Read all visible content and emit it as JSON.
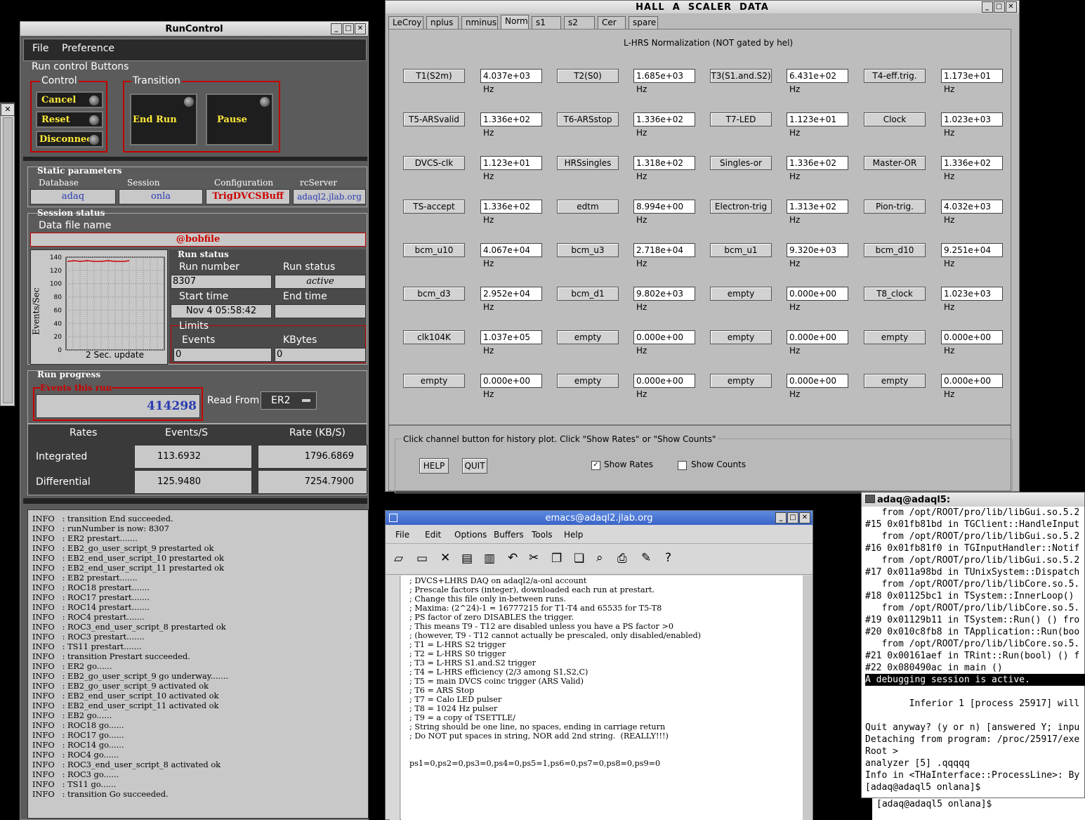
{
  "runcontrol": {
    "title": "RunControl",
    "menu": [
      "File",
      "Preference"
    ],
    "buttons_group": "Run control Buttons",
    "control_label": "Control",
    "control_buttons": [
      "Cancel",
      "Reset",
      "Disconnect"
    ],
    "transition_label": "Transition",
    "transition_buttons": [
      "End Run",
      "Pause"
    ],
    "static_params_label": "Static parameters",
    "static_params": [
      {
        "label": "Database",
        "value": "adaq"
      },
      {
        "label": "Session",
        "value": "onla"
      },
      {
        "label": "Configuration",
        "value": "TrigDVCSBuff"
      },
      {
        "label": "rcServer",
        "value": "adaql2.jlab.org"
      }
    ],
    "session_status_label": "Session status",
    "data_file_label": "Data file name",
    "data_file": "@bobfile",
    "plot": {
      "ylabel": "Events/Sec",
      "yticks": [
        "140",
        "120",
        "100",
        "80",
        "60",
        "40",
        "20",
        "0"
      ],
      "caption": "2 Sec. update"
    },
    "run_status_label": "Run status",
    "run_number_label": "Run number",
    "run_number": "8307",
    "run_status_field_label": "Run status",
    "run_status": "active",
    "start_time_label": "Start time",
    "start_time": "Nov 4 05:58:42",
    "end_time_label": "End time",
    "end_time": "",
    "limits_label": "Limits",
    "events_label": "Events",
    "events_limit": "0",
    "kbytes_label": "KBytes",
    "kbytes_limit": "0",
    "run_progress_label": "Run progress",
    "events_this_run_label": "Events this run",
    "events_this_run": "414298",
    "read_from_label": "Read From:",
    "read_from": "ER2",
    "rates_headers": [
      "Rates",
      "Events/S",
      "Rate (KB/S)"
    ],
    "rates": [
      {
        "label": "Integrated",
        "events": "113.6932",
        "rate": "1796.6869"
      },
      {
        "label": "Differential",
        "events": "125.9480",
        "rate": "7254.7900"
      }
    ],
    "log": [
      "INFO   : transition End succeeded.",
      "INFO   : runNumber is now: 8307",
      "INFO   : ER2 prestart.......",
      "INFO   : EB2_go_user_script_9 prestarted ok",
      "INFO   : EB2_end_user_script_10 prestarted ok",
      "INFO   : EB2_end_user_script_11 prestarted ok",
      "INFO   : EB2 prestart.......",
      "INFO   : ROC18 prestart.......",
      "INFO   : ROC17 prestart.......",
      "INFO   : ROC14 prestart.......",
      "INFO   : ROC4 prestart.......",
      "INFO   : ROC3_end_user_script_8 prestarted ok",
      "INFO   : ROC3 prestart.......",
      "INFO   : TS11 prestart.......",
      "INFO   : transition Prestart succeeded.",
      "INFO   : ER2 go......",
      "INFO   : EB2_go_user_script_9 go underway.......",
      "INFO   : EB2_go_user_script_9 activated ok",
      "INFO   : EB2_end_user_script_10 activated ok",
      "INFO   : EB2_end_user_script_11 activated ok",
      "INFO   : EB2 go......",
      "INFO   : ROC18 go......",
      "INFO   : ROC17 go......",
      "INFO   : ROC14 go......",
      "INFO   : ROC4 go......",
      "INFO   : ROC3_end_user_script_8 activated ok",
      "INFO   : ROC3 go......",
      "INFO   : TS11 go......",
      "INFO   : transition Go succeeded."
    ]
  },
  "scaler": {
    "title": "HALL  A  SCALER  DATA",
    "tabs": [
      "LeCroy",
      "nplus",
      "nminus",
      "Norm",
      "s1",
      "s2",
      "Cer",
      "spare"
    ],
    "active_tab": "Norm",
    "heading": "L-HRS Normalization (NOT gated by hel)",
    "rows": [
      [
        [
          "T1(S2m)",
          "4.037e+03 Hz"
        ],
        [
          "T2(S0)",
          "1.685e+03 Hz"
        ],
        [
          "T3(S1.and.S2)",
          "6.431e+02 Hz"
        ],
        [
          "T4-eff.trig.",
          "1.173e+01 Hz"
        ]
      ],
      [
        [
          "T5-ARSvalid",
          "1.336e+02 Hz"
        ],
        [
          "T6-ARSstop",
          "1.336e+02 Hz"
        ],
        [
          "T7-LED",
          "1.123e+01 Hz"
        ],
        [
          "Clock",
          "1.023e+03 Hz"
        ]
      ],
      [
        [
          "DVCS-clk",
          "1.123e+01 Hz"
        ],
        [
          "HRSsingles",
          "1.318e+02 Hz"
        ],
        [
          "Singles-or",
          "1.336e+02 Hz"
        ],
        [
          "Master-OR",
          "1.336e+02 Hz"
        ]
      ],
      [
        [
          "TS-accept",
          "1.336e+02 Hz"
        ],
        [
          "edtm",
          "8.994e+00 Hz"
        ],
        [
          "Electron-trig",
          "1.313e+02 Hz"
        ],
        [
          "Pion-trig.",
          "4.032e+03 Hz"
        ]
      ],
      [
        [
          "bcm_u10",
          "4.067e+04 Hz"
        ],
        [
          "bcm_u3",
          "2.718e+04 Hz"
        ],
        [
          "bcm_u1",
          "9.320e+03 Hz"
        ],
        [
          "bcm_d10",
          "9.251e+04 Hz"
        ]
      ],
      [
        [
          "bcm_d3",
          "2.952e+04 Hz"
        ],
        [
          "bcm_d1",
          "9.802e+03 Hz"
        ],
        [
          "empty",
          "0.000e+00 Hz"
        ],
        [
          "T8_clock",
          "1.023e+03 Hz"
        ]
      ],
      [
        [
          "clk104K",
          "1.037e+05 Hz"
        ],
        [
          "empty",
          "0.000e+00 Hz"
        ],
        [
          "empty",
          "0.000e+00 Hz"
        ],
        [
          "empty",
          "0.000e+00 Hz"
        ]
      ],
      [
        [
          "empty",
          "0.000e+00 Hz"
        ],
        [
          "empty",
          "0.000e+00 Hz"
        ],
        [
          "empty",
          "0.000e+00 Hz"
        ],
        [
          "empty",
          "0.000e+00 Hz"
        ]
      ]
    ],
    "footer_text": "Click channel button for history plot.  Click \"Show Rates\" or \"Show Counts\"",
    "help": "HELP",
    "quit": "QUIT",
    "show_rates": "Show Rates",
    "show_counts": "Show Counts"
  },
  "emacs": {
    "title": "emacs@adaql2.jlab.org",
    "menu": [
      "File",
      "Edit",
      "Options",
      "Buffers",
      "Tools",
      "Help"
    ],
    "lines": [
      "; DVCS+LHRS DAQ on adaql2/a-onl account",
      "; Prescale factors (integer), downloaded each run at prestart.",
      "; Change this file only in-between runs.",
      "; Maxima: (2^24)-1 = 16777215 for T1-T4 and 65535 for T5-T8",
      "; PS factor of zero DISABLES the trigger.",
      "; This means T9 - T12 are disabled unless you have a PS factor >0",
      "; (however, T9 - T12 cannot actually be prescaled, only disabled/enabled)",
      "; T1 = L-HRS S2 trigger",
      "; T2 = L-HRS S0 trigger",
      "; T3 = L-HRS S1.and.S2 trigger",
      "; T4 = L-HRS efficiency (2/3 among S1,S2,C)",
      "; T5 = main DVCS coinc trigger (ARS Valid)",
      "; T6 = ARS Stop",
      "; T7 = Calo LED pulser",
      "; T8 = 1024 Hz pulser",
      "; T9 = a copy of TSETTLE/",
      "; String should be one line, no spaces, ending in carriage return",
      "; Do NOT put spaces in string, NOR add 2nd string.  (REALLY!!!)",
      "",
      "",
      "ps1=0,ps2=0,ps3=0,ps4=0,ps5=1,ps6=0,ps7=0,ps8=0,ps9=0"
    ]
  },
  "terminal": {
    "title": "adaq@adaql5:",
    "lines": [
      "   from /opt/ROOT/pro/lib/libGui.so.5.2",
      "#15 0x01fb81bd in TGClient::HandleInput",
      "   from /opt/ROOT/pro/lib/libGui.so.5.2",
      "#16 0x01fb81f0 in TGInputHandler::Notif",
      "   from /opt/ROOT/pro/lib/libGui.so.5.2",
      "#17 0x011a98bd in TUnixSystem::Dispatch",
      "   from /opt/ROOT/pro/lib/libCore.so.5.",
      "#18 0x01125bc1 in TSystem::InnerLoop()",
      "   from /opt/ROOT/pro/lib/libCore.so.5.",
      "#19 0x01129b11 in TSystem::Run() () fro",
      "#20 0x010c8fb8 in TApplication::Run(boo",
      "   from /opt/ROOT/pro/lib/libCore.so.5.",
      "#21 0x00161aef in TRint::Run(bool) () f",
      "#22 0x080490ac in main ()"
    ],
    "highlight": "A debugging session is active.",
    "lines2": [
      "",
      "        Inferior 1 [process 25917] will",
      "",
      "Quit anyway? (y or n) [answered Y; inpu",
      "Detaching from program: /proc/25917/exe",
      "Root >",
      "analyzer [5] .qqqqq",
      "Info in <THaInterface::ProcessLine>: By",
      "[adaq@adaql5 onlana]$ "
    ],
    "prompt2": "[adaq@adaql5 onlana]$ "
  },
  "colors": {
    "accent_red": "#cc0000",
    "yellow_text": "#ffea3a",
    "emacs_title": "#3a64c8"
  }
}
